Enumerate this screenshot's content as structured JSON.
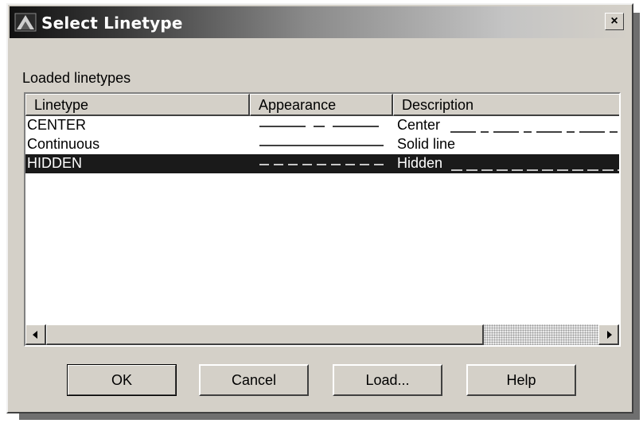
{
  "window": {
    "title": "Select Linetype",
    "close_glyph": "×"
  },
  "group_label": "Loaded linetypes",
  "columns": [
    "Linetype",
    "Appearance",
    "Description"
  ],
  "linetypes": [
    {
      "name": "CENTER",
      "appearance": "center",
      "description": "Center",
      "selected": false
    },
    {
      "name": "Continuous",
      "appearance": "continuous",
      "description": "Solid line",
      "selected": false
    },
    {
      "name": "HIDDEN",
      "appearance": "hidden",
      "description": "Hidden",
      "selected": true
    }
  ],
  "buttons": {
    "ok": "OK",
    "cancel": "Cancel",
    "load": "Load...",
    "help": "Help"
  },
  "icons": {
    "app": "autocad-icon",
    "close": "close-icon",
    "scroll_left": "arrow-left-icon",
    "scroll_right": "arrow-right-icon"
  },
  "colors": {
    "selection": "#1a1a1a",
    "dialog_face": "#d4d0c8"
  }
}
